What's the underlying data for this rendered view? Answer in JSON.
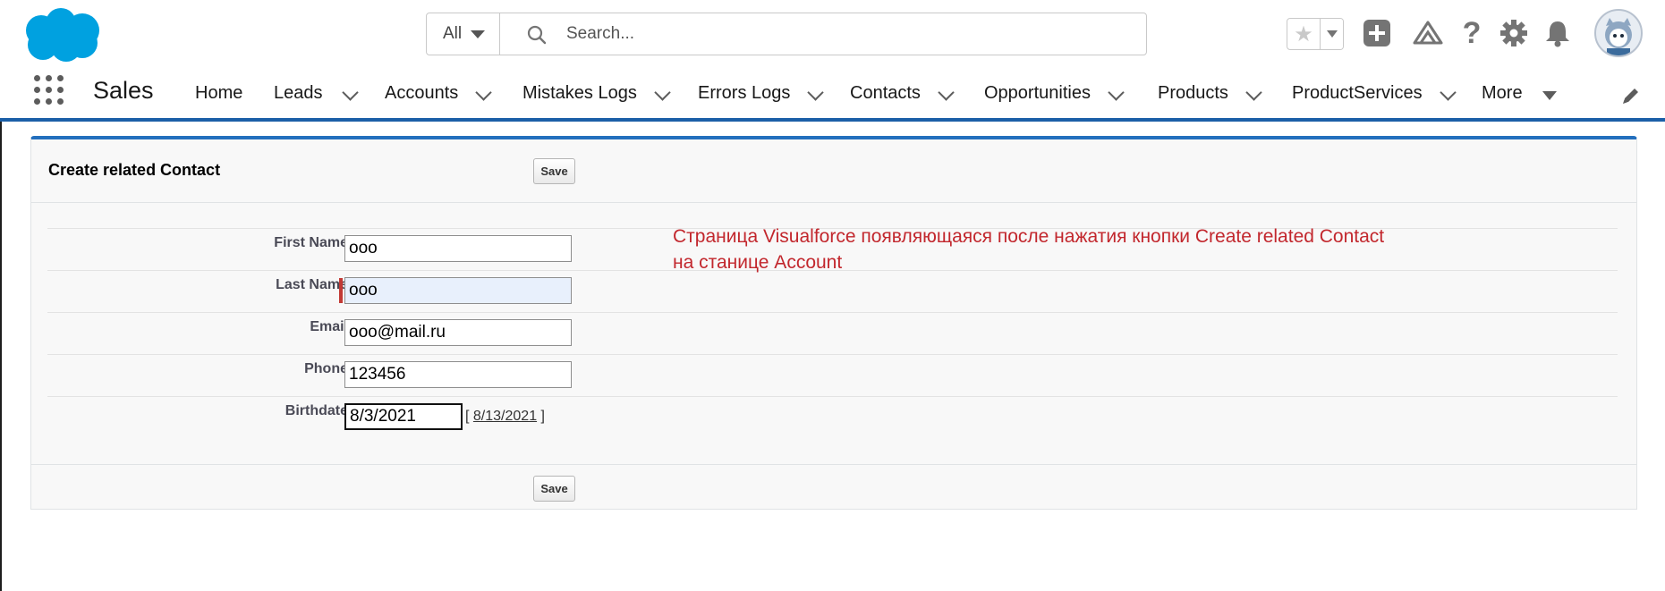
{
  "header": {
    "search": {
      "scope": "All",
      "placeholder": "Search..."
    },
    "icons": [
      "salesforce-cloud-logo",
      "favorite-star-icon",
      "add-icon",
      "trailhead-icon",
      "help-icon",
      "setup-gear-icon",
      "notifications-bell-icon",
      "user-avatar"
    ]
  },
  "nav": {
    "app_name": "Sales",
    "items": [
      {
        "label": "Home"
      },
      {
        "label": "Leads"
      },
      {
        "label": "Accounts"
      },
      {
        "label": "Mistakes Logs"
      },
      {
        "label": "Errors Logs"
      },
      {
        "label": "Contacts"
      },
      {
        "label": "Opportunities"
      },
      {
        "label": "Products"
      },
      {
        "label": "ProductServices"
      },
      {
        "label": "More"
      }
    ]
  },
  "page": {
    "title": "Create related Contact",
    "save_label": "Save",
    "fields": [
      {
        "label": "First Name",
        "value": "ooo"
      },
      {
        "label": "Last Name",
        "value": "ooo"
      },
      {
        "label": "Email",
        "value": "ooo@mail.ru"
      },
      {
        "label": "Phone",
        "value": "123456"
      },
      {
        "label": "Birthdate",
        "value": "8/3/2021",
        "today_link": "8/13/2021"
      }
    ],
    "date_link_open": "[",
    "date_link_close": "]"
  },
  "annotation": {
    "line1": "Страница Visualforce появляющаяся после нажатия кнопки Create related Contact",
    "line2": "на станице Account"
  },
  "colors": {
    "brand_blue": "#0176d3",
    "nav_underline": "#1b5fa7",
    "required_marker": "#c23934",
    "annotation_red": "#c2272d"
  }
}
